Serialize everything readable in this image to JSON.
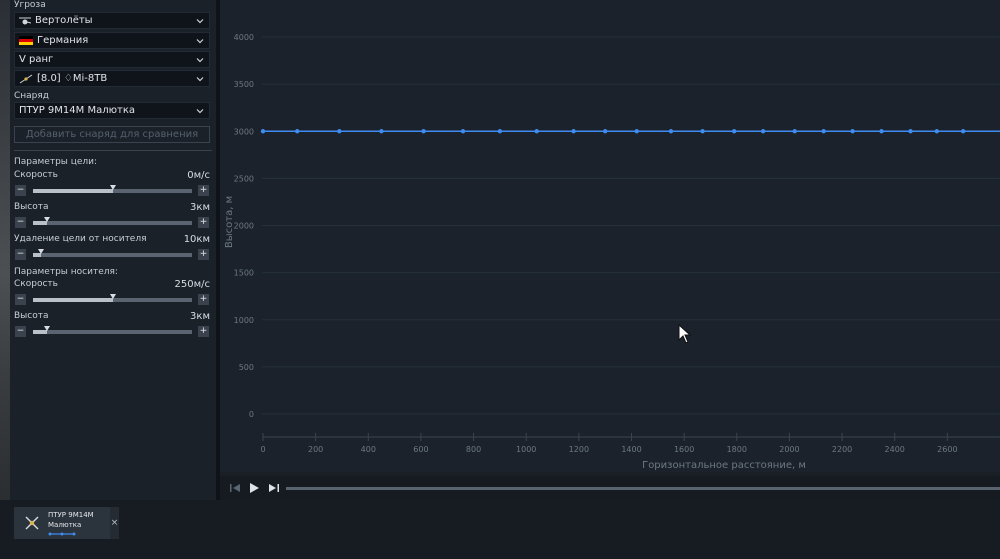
{
  "sidebar": {
    "threat_label": "Угроза",
    "threat_type": "Вертолёты",
    "country": "Германия",
    "rank": "V ранг",
    "vehicle": "[8.0] ♢Mi-8TB",
    "shell_label": "Снаряд",
    "shell": "ПТУР 9М14М Малютка",
    "add_shell_label": "Добавить снаряд для сравнения",
    "target_params_label": "Параметры цели:",
    "carrier_params_label": "Параметры носителя:",
    "target_params": [
      {
        "label": "Скорость",
        "value": "0м/с",
        "level": 0.5
      },
      {
        "label": "Высота",
        "value": "3км",
        "level": 0.09
      },
      {
        "label": "Удаление цели от носителя",
        "value": "10км",
        "level": 0.05
      }
    ],
    "carrier_params": [
      {
        "label": "Скорость",
        "value": "250м/с",
        "level": 0.5
      },
      {
        "label": "Высота",
        "value": "3км",
        "level": 0.09
      }
    ],
    "minus_glyph": "−",
    "plus_glyph": "+"
  },
  "chart_data": {
    "type": "line",
    "xlabel": "Горизонтальное расстояние, м",
    "ylabel": "Высота, м",
    "xlim": [
      0,
      2800
    ],
    "ylim": [
      0,
      4000
    ],
    "x_ticks": [
      0,
      200,
      400,
      600,
      800,
      1000,
      1200,
      1400,
      1600,
      1800,
      2000,
      2200,
      2400,
      2600
    ],
    "y_ticks": [
      0,
      500,
      1000,
      1500,
      2000,
      2500,
      3000,
      3500,
      4000
    ],
    "series": [
      {
        "color": "#3f8cf0",
        "x": [
          0,
          130,
          290,
          450,
          610,
          760,
          900,
          1040,
          1180,
          1300,
          1420,
          1550,
          1670,
          1790,
          1900,
          2020,
          2130,
          2240,
          2350,
          2460,
          2560,
          2660,
          2800
        ],
        "y": [
          3000,
          3000,
          3000,
          3000,
          3000,
          3000,
          3000,
          3000,
          3000,
          3000,
          3000,
          3000,
          3000,
          3000,
          3000,
          3000,
          3000,
          3000,
          3000,
          3000,
          3000,
          3000,
          3000
        ]
      }
    ],
    "grid": true
  },
  "player": {
    "progress": 0.0
  },
  "compare_card": {
    "title": "ПТУР 9М14М",
    "subtitle": "Малютка",
    "close_glyph": "×"
  },
  "colors": {
    "accent": "#3f8cf0",
    "panel": "#1b2129",
    "chart_bg": "#1b222b"
  }
}
